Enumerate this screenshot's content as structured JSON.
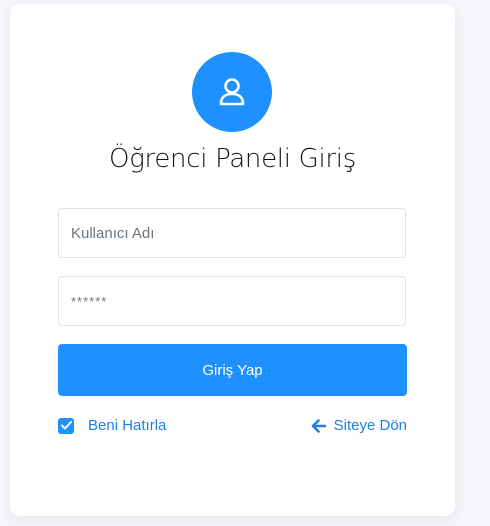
{
  "login": {
    "title": "Öğrenci Paneli Giriş",
    "username_placeholder": "Kullanıcı Adı",
    "password_placeholder": "******",
    "submit_label": "Giriş Yap",
    "remember_label": "Beni Hatırla",
    "remember_checked": true,
    "back_label": "Siteye Dön"
  },
  "icons": {
    "avatar": "user-icon",
    "checkbox": "check-icon",
    "back": "arrow-left-icon"
  },
  "colors": {
    "accent": "#1e90ff",
    "link": "#1e7fe6",
    "background": "#f5f6fa"
  }
}
